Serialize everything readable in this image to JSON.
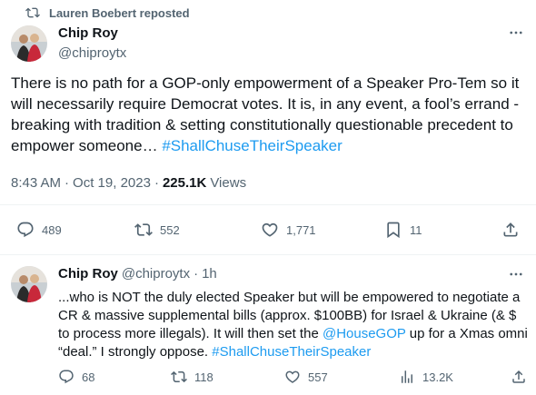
{
  "repost": {
    "text": "Lauren Boebert reposted"
  },
  "tweet1": {
    "author_name": "Chip Roy",
    "author_handle": "@chiproytx",
    "text_before_tag": "There is no path for a GOP-only empowerment of a Speaker Pro-Tem so it will necessarily require Democrat votes. It is, in any event, a fool’s errand - breaking with tradition & setting constitutionally questionable precedent to empower someone… ",
    "hashtag": "#ShallChuseTheirSpeaker",
    "time": "8:43 AM",
    "sep": "·",
    "date": "Oct 19, 2023",
    "sep2": "·",
    "views_count": "225.1K",
    "views_label": "Views",
    "replies": "489",
    "reposts": "552",
    "likes": "1,771",
    "bookmarks": "11"
  },
  "tweet2": {
    "author_name": "Chip Roy",
    "author_handle": "@chiproytx",
    "sep": "·",
    "time_ago": "1h",
    "text_part1": "...who is NOT the duly elected Speaker but will be empowered to negotiate a CR & massive supplemental bills (approx. $100BB) for Israel & Ukraine (& $ to process more illegals). It will then set the ",
    "mention": "@HouseGOP",
    "text_part2": " up for a Xmas omni “deal.”  I strongly oppose.  ",
    "hashtag": "#ShallChuseTheirSpeaker",
    "replies": "68",
    "reposts": "118",
    "likes": "557",
    "views": "13.2K"
  },
  "icons": {
    "repost": "repost-icon",
    "more": "more-icon",
    "reply": "reply-icon",
    "like": "heart-icon",
    "bookmark": "bookmark-icon",
    "share": "share-icon",
    "views": "views-icon"
  },
  "colors": {
    "accent": "#1d9bf0",
    "secondary_text": "#536471",
    "primary_text": "#0f1419",
    "divider": "#eff3f4"
  }
}
